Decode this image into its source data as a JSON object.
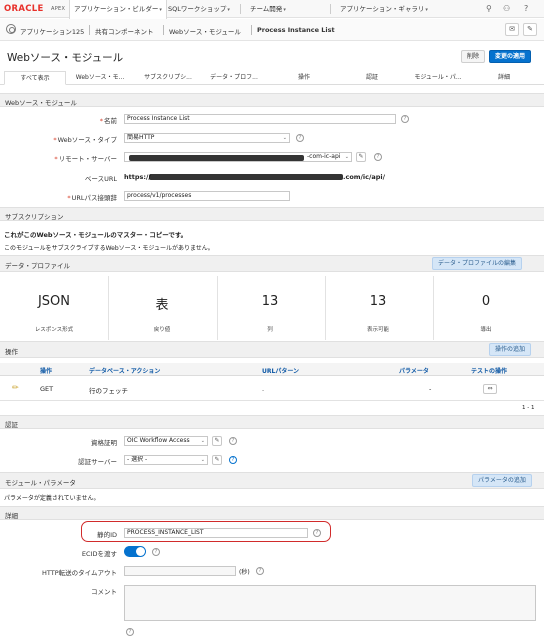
{
  "topnav": {
    "logo_oracle": "ORACLE",
    "logo_apex": "APEX",
    "tabs": [
      "アプリケーション・ビルダー",
      "SQLワークショップ",
      "チーム開発",
      "アプリケーション・ギャラリ"
    ]
  },
  "breadcrumb": {
    "items": [
      "アプリケーション125",
      "共有コンポーネント",
      "Webソース・モジュール",
      "Process Instance List"
    ]
  },
  "header": {
    "title": "Webソース・モジュール",
    "delete_label": "削除",
    "apply_label": "変更の適用"
  },
  "tabs": [
    "すべて表示",
    "Webソース・モ...",
    "サブスクリプシ...",
    "データ・プロフ...",
    "操作",
    "認証",
    "モジュール・パ...",
    "詳細"
  ],
  "module": {
    "section_title": "Webソース・モジュール",
    "name_label": "名前",
    "name_value": "Process Instance List",
    "type_label": "Webソース・タイプ",
    "type_value": "簡易HTTP",
    "remote_server_label": "リモート・サーバー",
    "remote_server_suffix": "-com-ic-api",
    "base_url_label": "ベースURL",
    "base_url_prefix": "https://",
    "base_url_suffix": ".com/ic/api/",
    "url_path_label": "URLパス接頭辞",
    "url_path_value": "process/v1/processes"
  },
  "subscription": {
    "section_title": "サブスクリプション",
    "master_text": "これがこのWebソース・モジュールのマスター・コピーです。",
    "no_subscribe_text": "このモジュールをサブスクライブするWebソース・モジュールがありません。"
  },
  "profile": {
    "section_title": "データ・プロファイル",
    "edit_button": "データ・プロファイルの編集",
    "stats": [
      {
        "value": "JSON",
        "label": "レスポンス形式"
      },
      {
        "value": "表",
        "label": "戻り値"
      },
      {
        "value": "13",
        "label": "列"
      },
      {
        "value": "13",
        "label": "表示可能"
      },
      {
        "value": "0",
        "label": "導出"
      }
    ]
  },
  "operations": {
    "section_title": "操作",
    "add_button": "操作の追加",
    "columns": [
      "操作",
      "データベース・アクション",
      "URLパターン",
      "パラメータ",
      "テストの操作"
    ],
    "rows": [
      {
        "operation": "GET",
        "action": "行のフェッチ",
        "url_pattern": ".",
        "params": "-"
      }
    ],
    "pagination": "1 - 1"
  },
  "auth": {
    "section_title": "認証",
    "credential_label": "資格証明",
    "credential_value": "OIC Workflow Access",
    "auth_server_label": "認証サーバー",
    "auth_server_value": "- 選択 -"
  },
  "params": {
    "section_title": "モジュール・パラメータ",
    "add_button": "パラメータの追加",
    "empty_text": "パラメータが定義されていません。"
  },
  "advanced": {
    "section_title": "詳細",
    "static_id_label": "静的ID",
    "static_id_value": "PROCESS_INSTANCE_LIST",
    "ecid_label": "ECIDを渡す",
    "timeout_label": "HTTP転送のタイムアウト",
    "timeout_unit": "(秒)",
    "comment_label": "コメント"
  },
  "colors": {
    "accent": "#0572ce",
    "oracle_red": "#e8302a",
    "highlight": "#d12b2b"
  }
}
